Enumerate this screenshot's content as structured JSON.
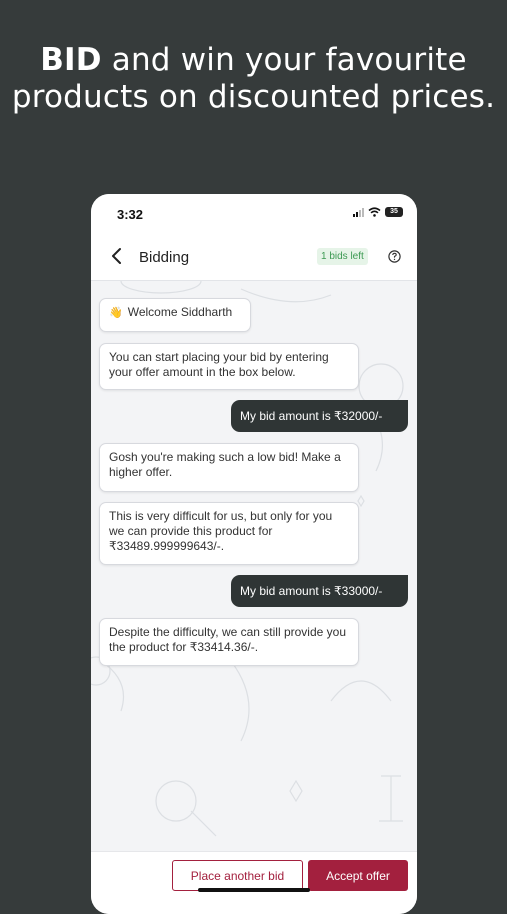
{
  "promo": {
    "headline_bold": "BID",
    "headline_rest": " and win your favourite products on discounted prices."
  },
  "status_bar": {
    "time": "3:32",
    "battery": "35"
  },
  "app_bar": {
    "title": "Bidding",
    "bids_left": "1 bids left",
    "back_icon": "chevron-left-icon",
    "help_icon": "question-circle-icon"
  },
  "chat": {
    "messages": [
      {
        "from": "bot",
        "emoji": "👋",
        "text": "Welcome Siddharth"
      },
      {
        "from": "bot",
        "text": "You can start placing your bid by entering your offer amount in the box below."
      },
      {
        "from": "user",
        "text": "My bid amount is ₹32000/-"
      },
      {
        "from": "bot",
        "text": "Gosh you're making such a low bid! Make a higher offer."
      },
      {
        "from": "bot",
        "text": "This is very difficult for us, but only for you we can provide this product for ₹33489.999999643/-."
      },
      {
        "from": "user",
        "text": "My bid amount is ₹33000/-"
      },
      {
        "from": "bot",
        "text": "Despite the difficulty, we can still provide you the product for ₹33414.36/-."
      }
    ]
  },
  "actions": {
    "place_another_bid": "Place another bid",
    "accept_offer": "Accept offer"
  },
  "colors": {
    "background": "#363b3b",
    "accent": "#a3203e",
    "user_bubble": "#2f3535",
    "bids_badge": "#3d9a53"
  }
}
